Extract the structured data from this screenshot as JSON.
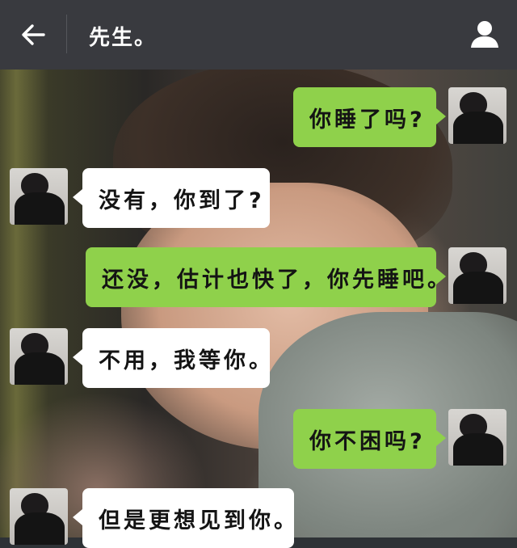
{
  "header": {
    "title": "先生。",
    "back_icon": "arrow-left-icon",
    "profile_icon": "person-icon"
  },
  "messages": [
    {
      "from": "me",
      "text": "你睡了吗?"
    },
    {
      "from": "other",
      "text": "没有，你到了?"
    },
    {
      "from": "me",
      "text": "还没，估计也快了，你先睡吧。"
    },
    {
      "from": "other",
      "text": "不用，我等你。"
    },
    {
      "from": "me",
      "text": "你不困吗?"
    },
    {
      "from": "other",
      "text": "但是更想见到你。"
    }
  ],
  "colors": {
    "header_bg": "#393a3f",
    "sent_bubble": "#8fd14b",
    "received_bubble": "#ffffff"
  }
}
